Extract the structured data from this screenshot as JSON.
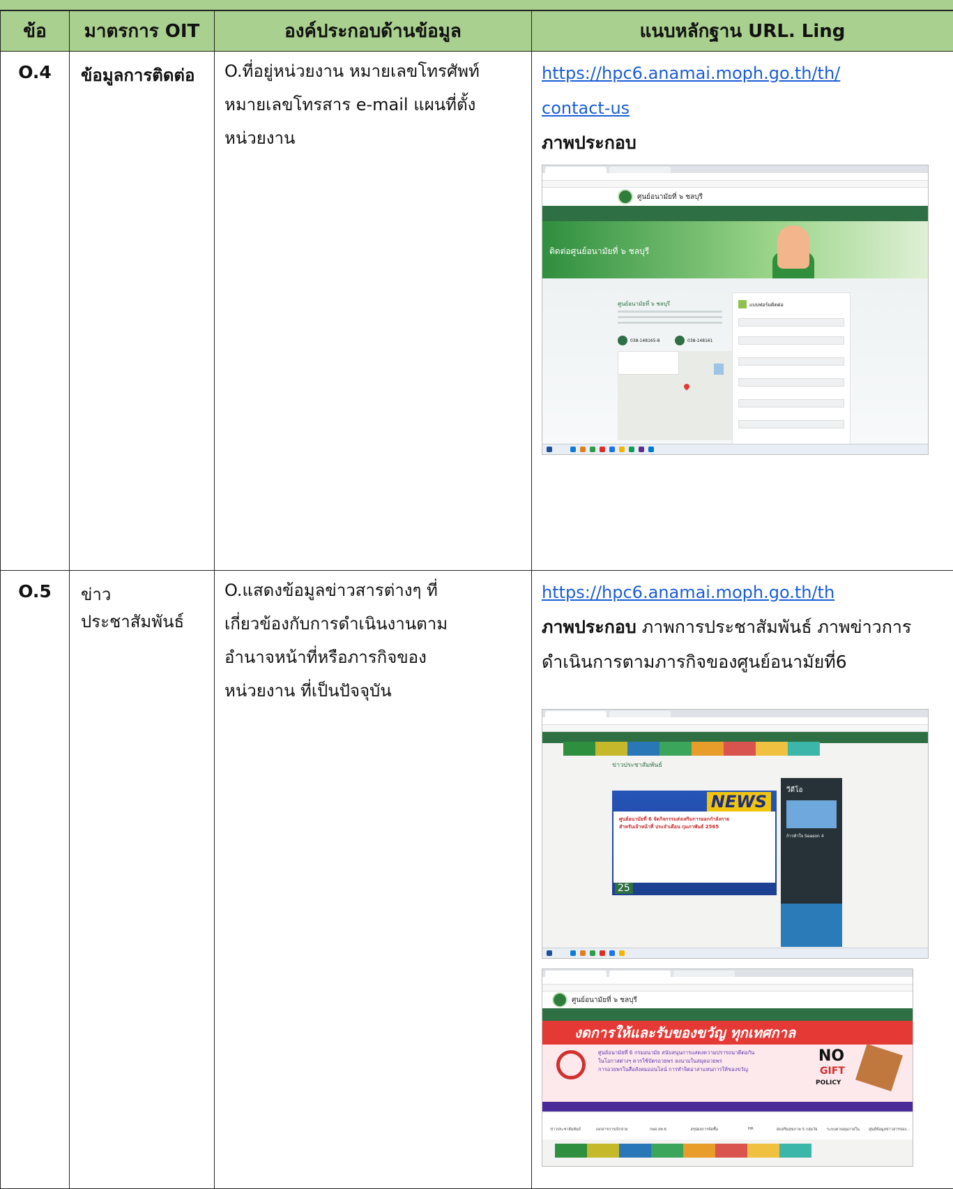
{
  "header": {
    "col1": "ข้อ",
    "col2": "มาตรการ OIT",
    "col3": "องค์ประกอบด้านข้อมูล",
    "col4": "แนบหลักฐาน URL. Ling"
  },
  "rows": [
    {
      "code": "O.4",
      "measure": "ข้อมูลการติดต่อ",
      "element_lines": [
        "O.ที่อยู่หน่วยงาน หมายเลขโทรศัพท์",
        "หมายเลขโทรสาร e-mail แผนที่ตั้ง",
        "หน่วยงาน"
      ],
      "links": [
        "https://hpc6.anamai.moph.go.th/th/",
        "contact-us"
      ],
      "evidence_label": "ภาพประกอบ",
      "screenshot": {
        "site_name": "ศูนย์อนามัยที่ ๖ ชลบุรี",
        "hero_text": "ติดต่อศูนย์อนามัยที่ ๖ ชลบุรี",
        "org_name": "ศูนย์อนามัยที่ ๖ ชลบุรี",
        "form_title": "แบบฟอร์มติดต่อ",
        "phone": "038-148165-8",
        "fax": "038-148161"
      }
    },
    {
      "code": "O.5",
      "measure": "ข่าวประชาสัมพันธ์",
      "element_lines": [
        "O.แสดงข้อมูลข่าวสารต่างๆ ที่",
        "เกี่ยวข้องกับการดำเนินงานตาม",
        "อำนาจหน้าที่หรือภารกิจของ",
        "หน่วยงาน ที่เป็นปัจจุบัน"
      ],
      "links": [
        "https://hpc6.anamai.moph.go.th/th"
      ],
      "evidence_label": "ภาพประกอบ",
      "evidence_text_1": " ภาพการประชาสัมพันธ์ ภาพข่าวการ",
      "evidence_text_2": "ดำเนินการตามภารกิจของศูนย์อนามัยที่6",
      "screenshot_a": {
        "section_title": "ข่าวประชาสัมพันธ์",
        "news_word": "NEWS",
        "news_headline_1": "ศูนย์อนามัยที่ 6 จัดกิจกรรมส่งเสริมการออกกำลังกาย",
        "news_headline_2": "สำหรับเจ้าหน้าที่ ประจำเดือน กุมภาพันธ์ 2565",
        "news_date": "25",
        "side_title": "วีดีโอ",
        "side_label": "ก้าวท้าใจ Season 4"
      },
      "screenshot_b": {
        "site_name": "ศูนย์อนามัยที่ ๖ ชลบุรี",
        "banner_text": "งดการให้และรับของขวัญ ทุกเทศกาล",
        "policy_1": "ศูนย์อนามัยที่ 6 กรมอนามัย สนับสนุนการแสดงความปรารถนาดีต่อกัน",
        "policy_2": "ในโอกาสต่างๆ ควรใช้บัตรอวยพร ลงนามในสมุดอวยพร",
        "policy_3": "การอวยพรในสื่อสังคมออนไลน์ การทำจิตอาสาแทนการให้ของขวัญ",
        "no": "NO",
        "gift": "GIFT",
        "policy": "POLICY",
        "categories": [
          "ข่าวประชาสัมพันธ์",
          "เอกสารการเบิกจ่าย",
          "กพส.สท.6",
          "สรุปผลการจัดซื้อ",
          "HR",
          "ส่งเสริมสุขภาพ 5 กลุ่มวัย",
          "ระบบควบคุมภายใน",
          "ศูนย์ข้อมูลข่าวสารของ..."
        ]
      }
    }
  ]
}
